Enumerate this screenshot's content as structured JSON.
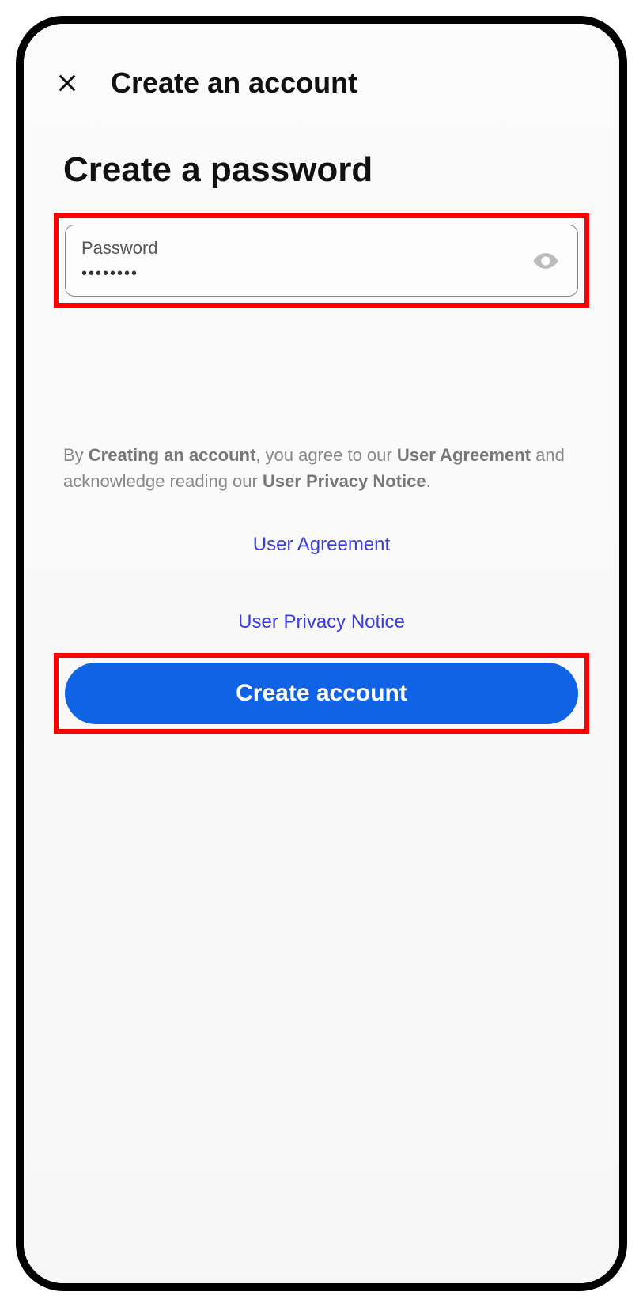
{
  "header": {
    "title": "Create an account"
  },
  "page": {
    "title": "Create a password"
  },
  "password": {
    "label": "Password",
    "value": "••••••••"
  },
  "legal": {
    "prefix": "By ",
    "bold1": "Creating an account",
    "mid1": ", you agree to our ",
    "bold2": "User Agreement",
    "mid2": " and acknowledge reading our ",
    "bold3": "User Privacy Notice",
    "suffix": "."
  },
  "links": {
    "agreement": "User Agreement",
    "privacy": "User Privacy Notice"
  },
  "button": {
    "create": "Create account"
  }
}
